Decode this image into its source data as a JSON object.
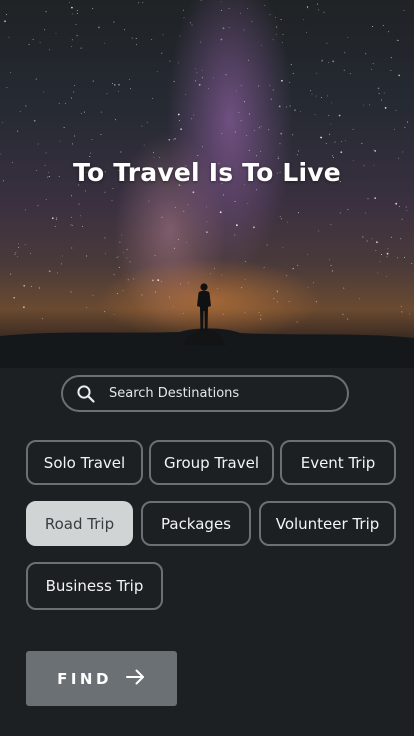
{
  "hero": {
    "title": "To Travel Is To Live"
  },
  "search": {
    "placeholder": "Search Destinations",
    "value": ""
  },
  "categories": [
    {
      "label": "Solo Travel",
      "selected": false
    },
    {
      "label": "Group Travel",
      "selected": false
    },
    {
      "label": "Event Trip",
      "selected": false
    },
    {
      "label": "Road Trip",
      "selected": true
    },
    {
      "label": "Packages",
      "selected": false
    },
    {
      "label": "Volunteer Trip",
      "selected": false
    },
    {
      "label": "Business Trip",
      "selected": false
    }
  ],
  "find_button": {
    "label": "FIND",
    "icon": "arrow-right-icon"
  },
  "colors": {
    "background": "#1c2023",
    "chip_border": "#6b7074",
    "chip_selected": "#d1d4d4",
    "button": "#6b7074",
    "text": "#ffffff"
  }
}
